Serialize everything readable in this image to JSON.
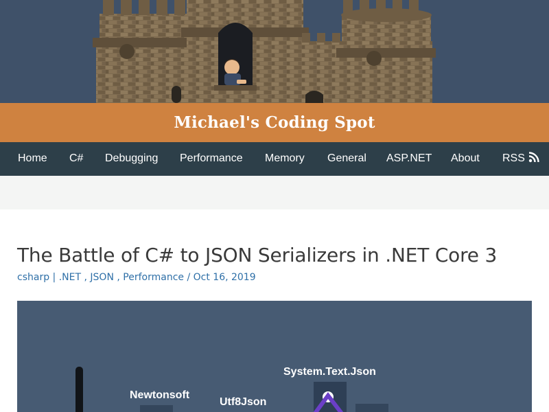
{
  "site": {
    "title": "Michael's Coding Spot",
    "banner_colors": {
      "sky": "#3f5169",
      "title_bar": "#cf8240",
      "nav": "#2d3f49"
    }
  },
  "nav": {
    "items": [
      {
        "label": "Home"
      },
      {
        "label": "C#"
      },
      {
        "label": "Debugging"
      },
      {
        "label": "Performance"
      },
      {
        "label": "Memory"
      },
      {
        "label": "General"
      },
      {
        "label": "ASP.NET"
      },
      {
        "label": "About"
      },
      {
        "label": "RSS",
        "icon": "rss-icon"
      }
    ]
  },
  "post": {
    "title": "The Battle of C# to JSON Serializers in .NET Core 3",
    "meta": {
      "author": "csharp",
      "categories": [
        ".NET",
        "JSON",
        "Performance"
      ],
      "date": "Oct 16, 2019"
    },
    "featured_image": {
      "labels": [
        "Newtonsoft",
        "Utf8Json",
        "System.Text.Json"
      ]
    }
  }
}
